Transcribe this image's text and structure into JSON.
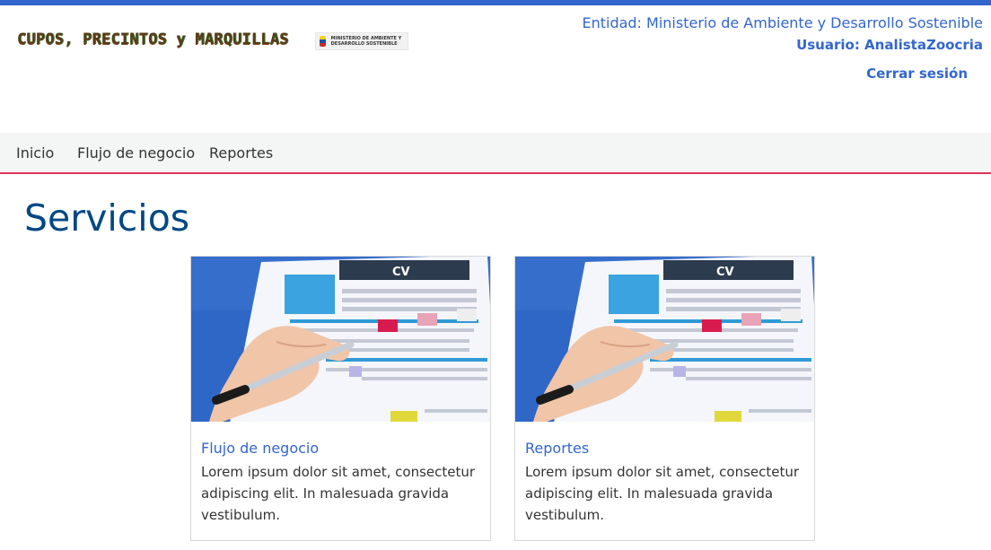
{
  "header": {
    "logo_text": "CUPOS, PRECINTOS y MARQUILLAS",
    "ministry_logo_text": "MINISTERIO DE AMBIENTE Y DESARROLLO SOSTENIBLE",
    "entity": "Entidad: Ministerio de Ambiente y Desarrollo Sostenible",
    "user": "Usuario: AnalistaZoocria",
    "logout": "Cerrar sesión"
  },
  "nav": {
    "items": [
      {
        "label": "Inicio"
      },
      {
        "label": "Flujo de negocio"
      },
      {
        "label": "Reportes"
      }
    ]
  },
  "main": {
    "title": "Servicios",
    "cards": [
      {
        "title": "Flujo de negocio",
        "text": "Lorem ipsum dolor sit amet, consectetur adipiscing elit. In malesuada gravida vestibulum.",
        "image_label": "CV"
      },
      {
        "title": "Reportes",
        "text": "Lorem ipsum dolor sit amet, consectetur adipiscing elit. In malesuada gravida vestibulum.",
        "image_label": "CV"
      }
    ]
  },
  "colors": {
    "accent": "#3366cc",
    "title": "#004884",
    "nav_border": "#e0335a",
    "image_bg": "#2f67c7"
  }
}
